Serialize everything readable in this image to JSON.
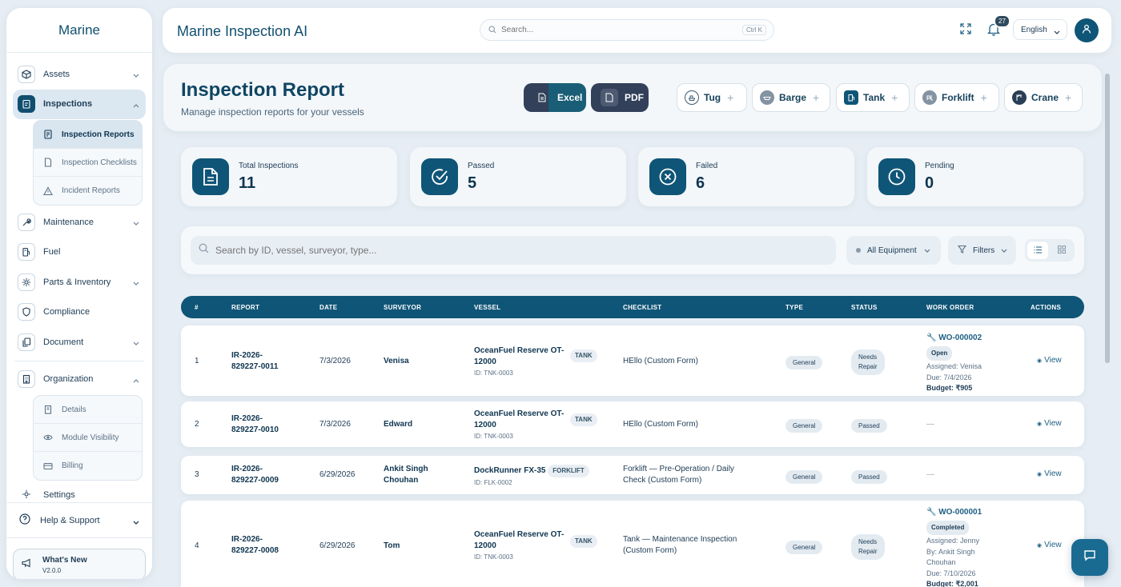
{
  "sidebar": {
    "brand": "Marine",
    "items": [
      {
        "label": "Assets"
      },
      {
        "label": "Inspections"
      },
      {
        "label": "Maintenance"
      },
      {
        "label": "Fuel"
      },
      {
        "label": "Parts & Inventory"
      },
      {
        "label": "Compliance"
      },
      {
        "label": "Document"
      },
      {
        "label": "Organization"
      },
      {
        "label": "Settings"
      }
    ],
    "inspections_sub": [
      "Inspection Reports",
      "Inspection Checklists",
      "Incident Reports"
    ],
    "organization_sub": [
      "Details",
      "Module Visibility",
      "Billing"
    ],
    "help": "Help & Support",
    "whats_new": {
      "title": "What's New",
      "version": "V2.0.0"
    }
  },
  "header": {
    "app_title": "Marine Inspection AI",
    "search_placeholder": "Search...",
    "shortcut": "Ctrl K",
    "notification_count": "27",
    "language": "English"
  },
  "page": {
    "title": "Inspection Report",
    "subtitle": "Manage inspection reports for your vessels",
    "export": {
      "excel": "Excel",
      "pdf": "PDF"
    },
    "equipment_buttons": [
      "Tug",
      "Barge",
      "Tank",
      "Forklift",
      "Crane"
    ]
  },
  "stats": [
    {
      "label": "Total Inspections",
      "value": "11"
    },
    {
      "label": "Passed",
      "value": "5"
    },
    {
      "label": "Failed",
      "value": "6"
    },
    {
      "label": "Pending",
      "value": "0"
    }
  ],
  "filters": {
    "search_placeholder": "Search by ID, vessel, surveyor, type...",
    "equipment": "All Equipment",
    "filters_label": "Filters"
  },
  "table": {
    "headers": [
      "#",
      "REPORT",
      "DATE",
      "SURVEYOR",
      "VESSEL",
      "CHECKLIST",
      "TYPE",
      "STATUS",
      "WORK ORDER",
      "ACTIONS"
    ],
    "view_label": "View",
    "rows": [
      {
        "num": "1",
        "report_a": "IR-2026-",
        "report_b": "829227-0011",
        "date": "7/3/2026",
        "surveyor_a": "Venisa",
        "surveyor_b": "",
        "vessel_a": "OceanFuel Reserve OT-",
        "vessel_b": "12000",
        "vessel_tag": "TANK",
        "vessel_id": "ID: TNK-0003",
        "checklist_a": "HEllo (Custom Form)",
        "checklist_b": "",
        "type": "General",
        "status_a": "Needs",
        "status_b": "Repair",
        "wo": {
          "number": "WO-000002",
          "state": "Open",
          "lines": [
            "Assigned: Venisa",
            "Due: 7/4/2026"
          ],
          "budget": "Budget: ₹905"
        }
      },
      {
        "num": "2",
        "report_a": "IR-2026-",
        "report_b": "829227-0010",
        "date": "7/3/2026",
        "surveyor_a": "Edward",
        "surveyor_b": "",
        "vessel_a": "OceanFuel Reserve OT-",
        "vessel_b": "12000",
        "vessel_tag": "TANK",
        "vessel_id": "ID: TNK-0003",
        "checklist_a": "HEllo (Custom Form)",
        "checklist_b": "",
        "type": "General",
        "status_a": "Passed",
        "status_b": "",
        "wo_none": "—"
      },
      {
        "num": "3",
        "report_a": "IR-2026-",
        "report_b": "829227-0009",
        "date": "6/29/2026",
        "surveyor_a": "Ankit Singh",
        "surveyor_b": "Chouhan",
        "vessel_a": "DockRunner FX-35",
        "vessel_b": "",
        "vessel_tag": "FORKLIFT",
        "vessel_id": "ID: FLK-0002",
        "checklist_a": "Forklift — Pre-Operation / Daily",
        "checklist_b": "Check (Custom Form)",
        "type": "General",
        "status_a": "Passed",
        "status_b": "",
        "wo_none": "—"
      },
      {
        "num": "4",
        "report_a": "IR-2026-",
        "report_b": "829227-0008",
        "date": "6/29/2026",
        "surveyor_a": "Tom",
        "surveyor_b": "",
        "vessel_a": "OceanFuel Reserve OT-",
        "vessel_b": "12000",
        "vessel_tag": "TANK",
        "vessel_id": "ID: TNK-0003",
        "checklist_a": "Tank — Maintenance Inspection",
        "checklist_b": "(Custom Form)",
        "type": "General",
        "status_a": "Needs",
        "status_b": "Repair",
        "wo": {
          "number": "WO-000001",
          "state": "Completed",
          "lines": [
            "Assigned: Jenny",
            "By: Ankit Singh",
            "Chouhan",
            "Due: 7/10/2026"
          ],
          "budget": "Budget: ₹2,001"
        }
      }
    ]
  },
  "colors": {
    "primary": "#0f5577",
    "dark_button": "#32405a",
    "background": "#e6edf4"
  }
}
